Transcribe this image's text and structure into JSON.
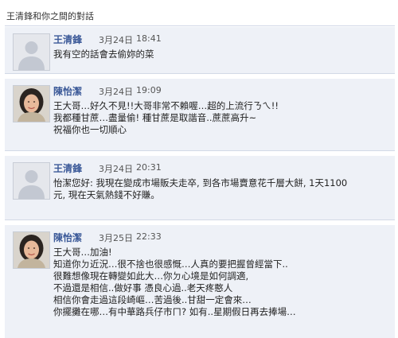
{
  "conversation": {
    "title": "王清鋒和你之間的對話"
  },
  "messages": [
    {
      "sender": "王清鋒",
      "date": "3月24日",
      "time": "18:41",
      "avatar": "default-profile-silhouette",
      "lines": [
        "我有空的話會去偷妳的菜"
      ]
    },
    {
      "sender": "陳怡潔",
      "date": "3月24日",
      "time": "19:09",
      "avatar": "profile-photo-woman",
      "lines": [
        "王大哥…好久不見!!大哥非常不賴喔…超的上流行ㄋㄟ!!",
        "我都種甘蔗…盡量偷! 種甘蔗是取諧音..蔗蔗高升~",
        "祝福你也一切順心"
      ]
    },
    {
      "sender": "王清鋒",
      "date": "3月24日",
      "time": "20:31",
      "avatar": "default-profile-silhouette",
      "lines": [
        "怡潔您好: 我現在變成市場販夫走卒, 到各市場賣意花千層大餅, 1天1100",
        "元, 現在天氣熱錢不好賺。"
      ]
    },
    {
      "sender": "陳怡潔",
      "date": "3月25日",
      "time": "22:33",
      "avatar": "profile-photo-woman",
      "lines": [
        "王大哥…加油!",
        "知道你ㄉ近況…很不捨也很感慨…人真的要把握曾經當下..",
        "很難想像現在轉變如此大…你ㄉ心境是如何調適,",
        "不過還是相信..做好事 憑良心過..老天疼憨人",
        "相信你會走過這段崎嶇…苦過後..甘甜一定會來…",
        "你擺攤在哪…有中華路兵仔市ㄇ? 如有..星期假日再去捧場…"
      ]
    }
  ],
  "colors": {
    "sender_link": "#3b5998",
    "message_background": "#eef1f7",
    "divider": "#d3d9e6"
  }
}
